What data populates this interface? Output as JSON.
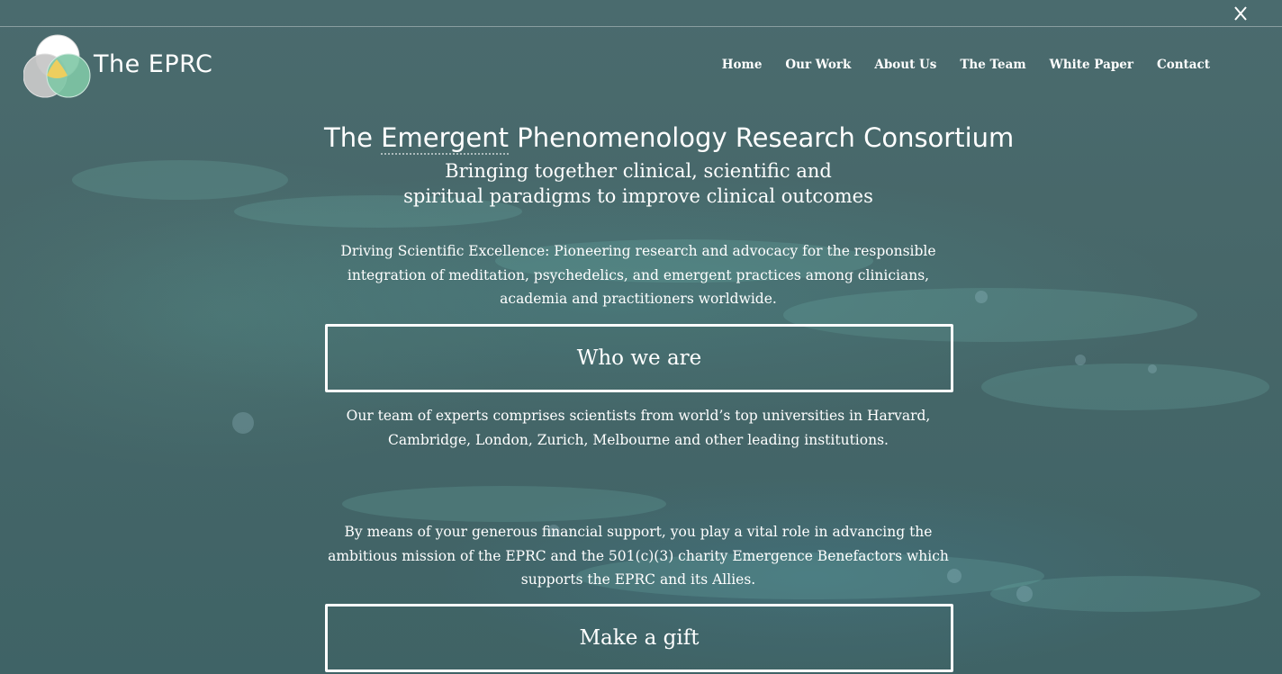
{
  "header": {
    "brand": "The EPRC",
    "nav": [
      "Home",
      "Our Work",
      "About Us",
      "The Team",
      "White Paper",
      "Contact"
    ]
  },
  "hero": {
    "title_pre": "The ",
    "title_dotted": "Emergent",
    "title_post": " Phenomenology Research Consortium",
    "subtitle_line1": "Bringing together clinical, scientific and",
    "subtitle_line2": "spiritual paradigms to improve clinical outcomes",
    "intro": "Driving Scientific Excellence: Pioneering research and advocacy for the responsible integration of meditation, psychedelics, and emergent practices among clinicians, academia and practitioners worldwide.",
    "who_button": "Who we are",
    "team_text": "Our team of experts comprises scientists from world’s top universities in Harvard, Cambridge, London, Zurich, Melbourne and other leading institutions.",
    "support_text": "By means of your generous financial support, you play a vital role in advancing the ambitious mission of the EPRC and the 501(c)(3) charity Emergence Benefactors which supports the EPRC and its Allies.",
    "gift_button": "Make a gift"
  },
  "icons": {
    "close": "close-x-icon",
    "logo": "venn-diagram-logo"
  },
  "colors": {
    "overlay": "#44666a",
    "text": "#ffffff",
    "logo_yellow": "#f2cf5b",
    "logo_green": "#7fc8a6",
    "logo_gray": "#c9c9c9"
  }
}
